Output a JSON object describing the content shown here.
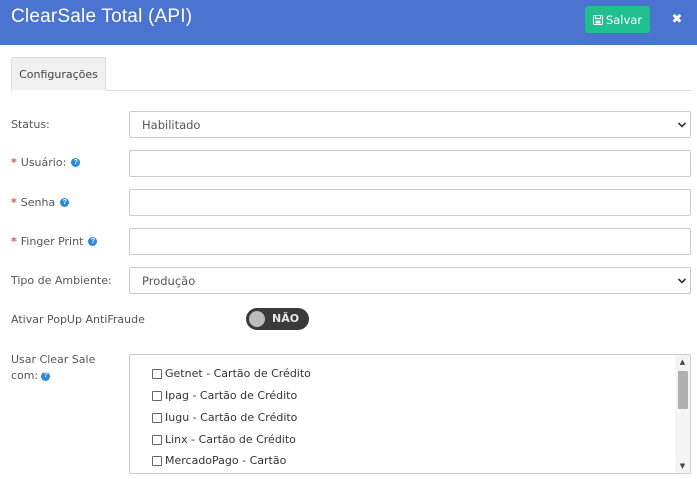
{
  "header": {
    "title": "ClearSale Total (API)",
    "save_label": "Salvar",
    "close_glyph": "✖",
    "accent": "#4a74cf",
    "save_color": "#1fbf8f"
  },
  "tabs": [
    {
      "label": "Configurações"
    }
  ],
  "form": {
    "status": {
      "label": "Status:",
      "value": "Habilitado"
    },
    "usuario": {
      "label": "Usuário:",
      "required_mark": "*",
      "value": ""
    },
    "senha": {
      "label": "Senha",
      "required_mark": "*",
      "value": ""
    },
    "finger_print": {
      "label": "Finger Print",
      "required_mark": "*",
      "value": ""
    },
    "tipo_ambiente": {
      "label": "Tipo de Ambiente:",
      "value": "Produção"
    },
    "popup": {
      "label": "Ativar PopUp AntiFraude",
      "toggle_text": "NÃO",
      "enabled": false
    },
    "usar": {
      "label_line1": "Usar Clear Sale",
      "label_line2": "com:",
      "options": [
        "Getnet - Cartão de Crédito",
        "Ipag - Cartão de Crédito",
        "Iugu - Cartão de Crédito",
        "Linx - Cartão de Crédito",
        "MercadoPago - Cartão"
      ]
    }
  },
  "icons": {
    "help": "question-circle-icon",
    "save": "floppy-disk-icon",
    "close": "close-icon",
    "select": "chevron-down-icon"
  }
}
